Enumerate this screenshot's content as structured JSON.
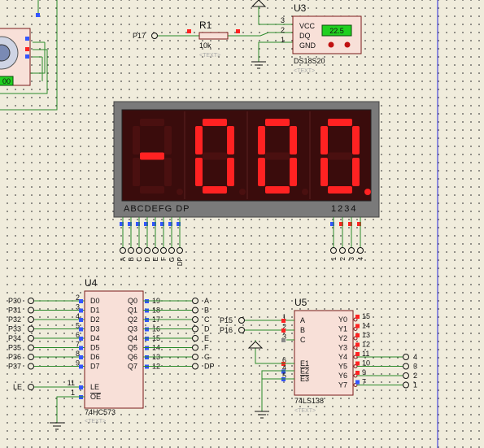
{
  "colors": {
    "background": "#f0ecdc",
    "wire": "#2a8a2a",
    "component_body": "#f8e0d8",
    "component_border": "#7a1a1a",
    "pin_high": "#ff2222",
    "pin_low": "#3355ff",
    "pin_float": "#888888",
    "display_frame": "#7a7a7a",
    "display_panel": "#3a0c0c",
    "segment_on": "#ff2222",
    "segment_off": "#4a1010",
    "sensor_display": "#20d020",
    "divider": "#4a4adc"
  },
  "top_left_fragment": {
    "value_display": "00"
  },
  "resistor": {
    "ref": "R1",
    "value": "10k",
    "text": "<TEXT>",
    "net_label": "P17"
  },
  "sensor": {
    "ref": "U3",
    "part": "DS18S20",
    "text": "<TEXT>",
    "reading": "22.5",
    "pins": [
      {
        "num": "3",
        "name": "VCC"
      },
      {
        "num": "2",
        "name": "DQ"
      },
      {
        "num": "1",
        "name": "GND"
      }
    ]
  },
  "display": {
    "digits": [
      "-",
      "0",
      "0",
      "0"
    ],
    "decimal_point_digit": 3,
    "segment_label": "ABCDEFG  DP",
    "digit_label": "1234",
    "segment_pins": [
      "A",
      "B",
      "C",
      "D",
      "E",
      "F",
      "G",
      "DP"
    ],
    "digit_pins": [
      "1",
      "2",
      "3",
      "4"
    ]
  },
  "latch": {
    "ref": "U4",
    "part": "74HC573",
    "text": "<TEXT>",
    "inputs": [
      {
        "net": "P30",
        "num": "2",
        "name": "D0"
      },
      {
        "net": "P31",
        "num": "3",
        "name": "D1"
      },
      {
        "net": "P32",
        "num": "4",
        "name": "D2"
      },
      {
        "net": "P33",
        "num": "5",
        "name": "D3"
      },
      {
        "net": "P34",
        "num": "6",
        "name": "D4"
      },
      {
        "net": "P35",
        "num": "7",
        "name": "D5"
      },
      {
        "net": "P36",
        "num": "8",
        "name": "D6"
      },
      {
        "net": "P37",
        "num": "9",
        "name": "D7"
      }
    ],
    "outputs": [
      {
        "num": "19",
        "name": "Q0",
        "net": "A"
      },
      {
        "num": "18",
        "name": "Q1",
        "net": "B"
      },
      {
        "num": "17",
        "name": "Q2",
        "net": "C"
      },
      {
        "num": "16",
        "name": "Q3",
        "net": "D"
      },
      {
        "num": "15",
        "name": "Q4",
        "net": "E"
      },
      {
        "num": "14",
        "name": "Q5",
        "net": "F"
      },
      {
        "num": "13",
        "name": "Q6",
        "net": "G"
      },
      {
        "num": "12",
        "name": "Q7",
        "net": "DP"
      }
    ],
    "le": {
      "net": "LE",
      "num": "11",
      "name": "LE"
    },
    "oe": {
      "num": "1",
      "name": "OE"
    }
  },
  "decoder": {
    "ref": "U5",
    "part": "74LS138",
    "text": "<TEXT>",
    "inputs": [
      {
        "net": "P15",
        "num": "1",
        "name": "A"
      },
      {
        "net": "P16",
        "num": "2",
        "name": "B"
      },
      {
        "net": "",
        "num": "3",
        "name": "C"
      }
    ],
    "enables": [
      {
        "num": "6",
        "name": "E1"
      },
      {
        "num": "4",
        "name": "E2"
      },
      {
        "num": "5",
        "name": "E3"
      }
    ],
    "outputs": [
      {
        "num": "15",
        "name": "Y0",
        "net": ""
      },
      {
        "num": "14",
        "name": "Y1",
        "net": ""
      },
      {
        "num": "13",
        "name": "Y2",
        "net": ""
      },
      {
        "num": "12",
        "name": "Y3",
        "net": ""
      },
      {
        "num": "11",
        "name": "Y4",
        "net": "4"
      },
      {
        "num": "10",
        "name": "Y5",
        "net": "3"
      },
      {
        "num": "9",
        "name": "Y6",
        "net": "2"
      },
      {
        "num": "7",
        "name": "Y7",
        "net": "1"
      }
    ]
  }
}
